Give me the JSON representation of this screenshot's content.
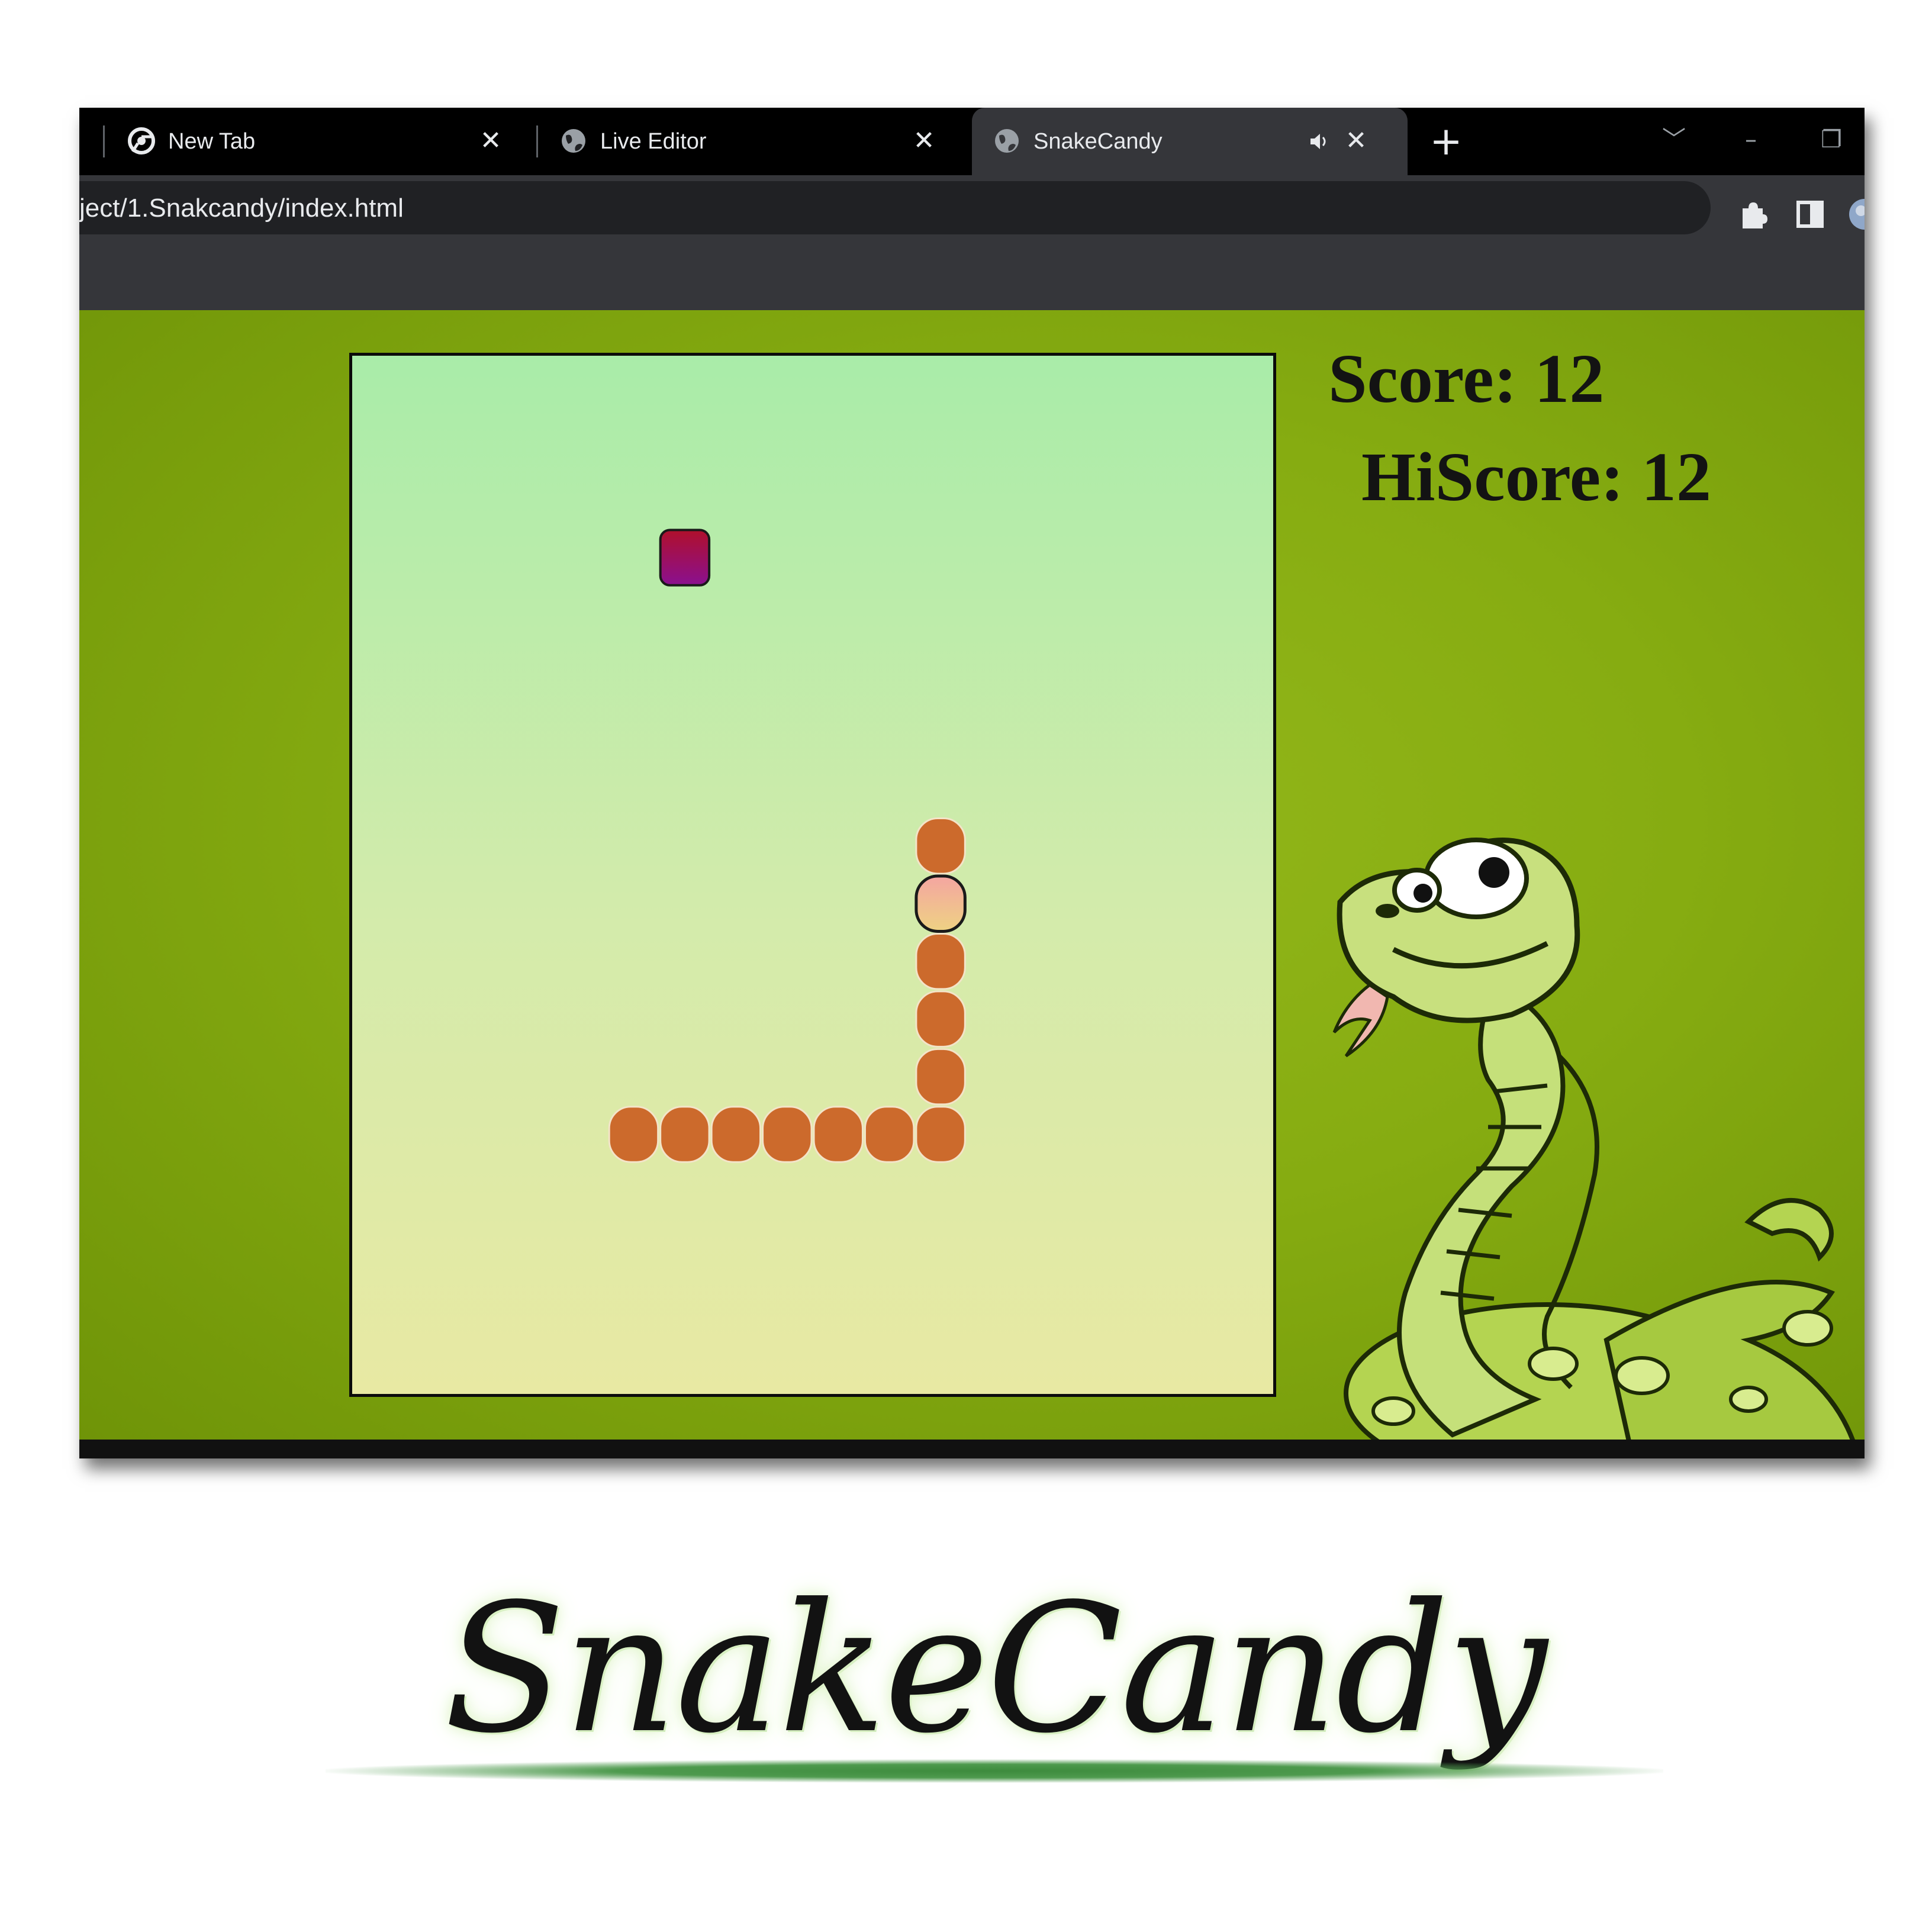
{
  "browser": {
    "tabs": [
      {
        "title": "New Tab",
        "icon": "chrome-icon"
      },
      {
        "title": "Live Editor",
        "icon": "globe-icon"
      },
      {
        "title": "SnakeCandy",
        "icon": "globe-icon",
        "active": true,
        "audio": true
      }
    ],
    "close_glyph": "✕",
    "new_tab_glyph": "+",
    "controls": {
      "tab_search": "﹀",
      "minimize": "–",
      "restore": "❐"
    },
    "url": "ject/1.Snakcandy/index.html",
    "colors": {
      "tabstrip": "#000000",
      "active_tab": "#35363a",
      "omnibox": "#202124"
    }
  },
  "game": {
    "score_text": "Score: 12",
    "hiscore_text": "HiScore: 12",
    "board": {
      "cols": 18,
      "rows": 18
    },
    "food": {
      "col": 6,
      "row": 3
    },
    "snake_head": {
      "col": 11,
      "row": 9
    },
    "snake_body": [
      {
        "col": 11,
        "row": 8
      },
      {
        "col": 11,
        "row": 10
      },
      {
        "col": 11,
        "row": 11
      },
      {
        "col": 11,
        "row": 12
      },
      {
        "col": 11,
        "row": 13
      },
      {
        "col": 10,
        "row": 13
      },
      {
        "col": 9,
        "row": 13
      },
      {
        "col": 8,
        "row": 13
      },
      {
        "col": 7,
        "row": 13
      },
      {
        "col": 6,
        "row": 13
      },
      {
        "col": 5,
        "row": 13
      }
    ],
    "colors": {
      "page_bg": "#86ac11",
      "snake_body": "#cc6a2c",
      "head_top": "#f4a5a1",
      "head_bottom": "#eed283",
      "food_top": "#b0102b",
      "food_bottom": "#8a1090"
    },
    "mascot": "cartoon-snake-mascot"
  },
  "branding": {
    "title": "SnakeCandy"
  }
}
